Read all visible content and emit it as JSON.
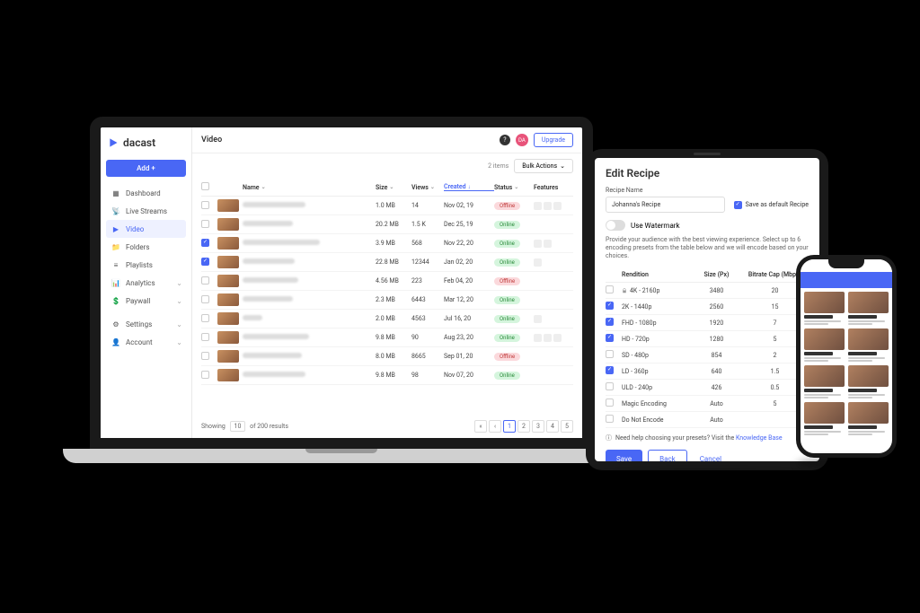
{
  "brand": "dacast",
  "sidebar": {
    "add_label": "Add +",
    "items": [
      {
        "label": "Dashboard"
      },
      {
        "label": "Live Streams"
      },
      {
        "label": "Video"
      },
      {
        "label": "Folders"
      },
      {
        "label": "Playlists"
      },
      {
        "label": "Analytics"
      },
      {
        "label": "Paywall"
      }
    ],
    "settings_label": "Settings",
    "account_label": "Account"
  },
  "header": {
    "title": "Video",
    "upgrade_label": "Upgrade",
    "avatar_initials": "DA"
  },
  "toolbar": {
    "items_count": "2 items",
    "bulk_label": "Bulk Actions"
  },
  "columns": {
    "name": "Name",
    "size": "Size",
    "views": "Views",
    "created": "Created",
    "status": "Status",
    "features": "Features"
  },
  "rows": [
    {
      "checked": false,
      "name_width": 70,
      "size": "1.0 MB",
      "views": "14",
      "created": "Nov 02, 19",
      "status": "Offline",
      "features": 3
    },
    {
      "checked": false,
      "name_width": 56,
      "size": "20.2 MB",
      "views": "1.5 K",
      "created": "Dec 25, 19",
      "status": "Online",
      "features": 0
    },
    {
      "checked": true,
      "name_width": 86,
      "size": "3.9 MB",
      "views": "568",
      "created": "Nov 22, 20",
      "status": "Online",
      "features": 2
    },
    {
      "checked": true,
      "name_width": 58,
      "size": "22.8 MB",
      "views": "12344",
      "created": "Jan 02, 20",
      "status": "Online",
      "features": 1
    },
    {
      "checked": false,
      "name_width": 62,
      "size": "4.56 MB",
      "views": "223",
      "created": "Feb 04, 20",
      "status": "Offline",
      "features": 0
    },
    {
      "checked": false,
      "name_width": 56,
      "size": "2.3 MB",
      "views": "6443",
      "created": "Mar 12, 20",
      "status": "Online",
      "features": 0
    },
    {
      "checked": false,
      "name_width": 22,
      "size": "2.0 MB",
      "views": "4563",
      "created": "Jul 16, 20",
      "status": "Online",
      "features": 1
    },
    {
      "checked": false,
      "name_width": 74,
      "size": "9.8 MB",
      "views": "90",
      "created": "Aug 23, 20",
      "status": "Online",
      "features": 3
    },
    {
      "checked": false,
      "name_width": 66,
      "size": "8.0 MB",
      "views": "8665",
      "created": "Sep 01, 20",
      "status": "Offline",
      "features": 0
    },
    {
      "checked": false,
      "name_width": 70,
      "size": "9.8 MB",
      "views": "98",
      "created": "Nov 07, 20",
      "status": "Online",
      "features": 0
    }
  ],
  "pagination": {
    "showing": "Showing",
    "per_page": "10",
    "of_results": "of 200 results",
    "pages": [
      "1",
      "2",
      "3",
      "4",
      "5"
    ]
  },
  "recipe": {
    "title": "Edit Recipe",
    "name_label": "Recipe Name",
    "name_value": "Johanna's Recipe",
    "default_label": "Save as default Recipe",
    "watermark_label": "Use Watermark",
    "description": "Provide your audience with the best viewing experience. Select up to 6 encoding presets from the table below and we will encode based on your choices.",
    "col_rendition": "Rendition",
    "col_size": "Size (Px)",
    "col_bitrate": "Bitrate Cap (Mbps)",
    "presets": [
      {
        "checked": false,
        "locked": true,
        "name": "4K - 2160p",
        "px": "3480",
        "bitrate": "20"
      },
      {
        "checked": true,
        "locked": false,
        "name": "2K - 1440p",
        "px": "2560",
        "bitrate": "15"
      },
      {
        "checked": true,
        "locked": false,
        "name": "FHD - 1080p",
        "px": "1920",
        "bitrate": "7"
      },
      {
        "checked": true,
        "locked": false,
        "name": "HD - 720p",
        "px": "1280",
        "bitrate": "5"
      },
      {
        "checked": false,
        "locked": false,
        "name": "SD - 480p",
        "px": "854",
        "bitrate": "2"
      },
      {
        "checked": true,
        "locked": false,
        "name": "LD - 360p",
        "px": "640",
        "bitrate": "1.5"
      },
      {
        "checked": false,
        "locked": false,
        "name": "ULD - 240p",
        "px": "426",
        "bitrate": "0.5"
      },
      {
        "checked": false,
        "locked": false,
        "name": "Magic Encoding",
        "px": "Auto",
        "bitrate": "5"
      },
      {
        "checked": false,
        "locked": false,
        "name": "Do Not Encode",
        "px": "Auto",
        "bitrate": ""
      }
    ],
    "help_text": "Need help choosing your presets? Visit the ",
    "help_link": "Knowledge Base",
    "save_label": "Save",
    "back_label": "Back",
    "cancel_label": "Cancel"
  }
}
